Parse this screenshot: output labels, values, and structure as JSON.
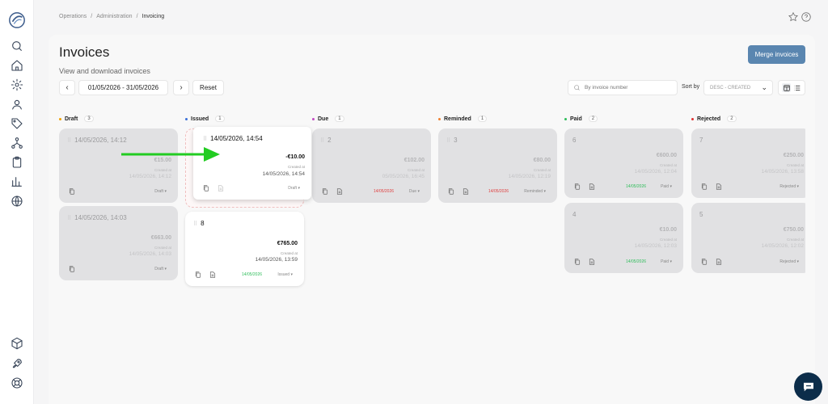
{
  "breadcrumb": [
    "Operations",
    "Administration",
    "Invoicing"
  ],
  "page": {
    "title": "Invoices",
    "subtitle": "View and download invoices",
    "merge_label": "Merge invoices"
  },
  "filters": {
    "date_range": "01/05/2026 - 31/05/2026",
    "reset_label": "Reset",
    "search_placeholder": "By invoice number",
    "sort_by_label": "Sort by",
    "sort_value": "DESC - CREATED"
  },
  "columns": [
    {
      "name": "Draft",
      "count": "3",
      "color": "#f0a000"
    },
    {
      "name": "Issued",
      "count": "1",
      "color": "#3b6fd8"
    },
    {
      "name": "Due",
      "count": "1",
      "color": "#c44ac4"
    },
    {
      "name": "Reminded",
      "count": "1",
      "color": "#f08030"
    },
    {
      "name": "Paid",
      "count": "2",
      "color": "#2ebd5a"
    },
    {
      "name": "Rejected",
      "count": "2",
      "color": "#e03030"
    }
  ],
  "cards": [
    {
      "id": "14/05/2026, 14:12",
      "amount": "€15.00",
      "created_label": "Created at",
      "created": "14/05/2026, 14:12",
      "due": "",
      "status": "Draft"
    },
    {
      "id": "14/05/2026, 14:03",
      "amount": "€663.00",
      "created_label": "Created at",
      "created": "14/05/2026, 14:03",
      "due": "",
      "status": "Draft"
    },
    {
      "id": "8",
      "amount": "€765.00",
      "created_label": "Created at",
      "created": "14/05/2026, 13:59",
      "due": "14/05/2026",
      "status": "Issued"
    },
    {
      "id": "2",
      "amount": "€102.00",
      "created_label": "Created at",
      "created": "05/05/2026, 16:45",
      "due": "14/05/2026",
      "status": "Due"
    },
    {
      "id": "3",
      "amount": "€80.00",
      "created_label": "Created at",
      "created": "14/05/2026, 12:19",
      "due": "14/05/2026",
      "status": "Reminded"
    },
    {
      "id": "6",
      "amount": "€600.00",
      "created_label": "Created at",
      "created": "14/05/2026, 12:04",
      "due": "14/05/2026",
      "status": "Paid"
    },
    {
      "id": "4",
      "amount": "€10.00",
      "created_label": "Created at",
      "created": "14/05/2026, 12:03",
      "due": "14/05/2026",
      "status": "Paid"
    },
    {
      "id": "7",
      "amount": "€250.00",
      "created_label": "Created at",
      "created": "14/05/2026, 13:58",
      "due": "",
      "status": "Rejected"
    },
    {
      "id": "5",
      "amount": "€750.00",
      "created_label": "Created at",
      "created": "14/05/2026, 12:02",
      "due": "",
      "status": "Rejected"
    }
  ],
  "dragged_card": {
    "id": "14/05/2026, 14:54",
    "amount": "-€10.00",
    "created_label": "Created at",
    "created": "14/05/2026, 14:54",
    "status": "Draft"
  },
  "colors": {
    "accent": "#5a86b0",
    "due_red": "#e04040",
    "due_green": "#2ebd5a",
    "arrow": "#22cc22"
  }
}
